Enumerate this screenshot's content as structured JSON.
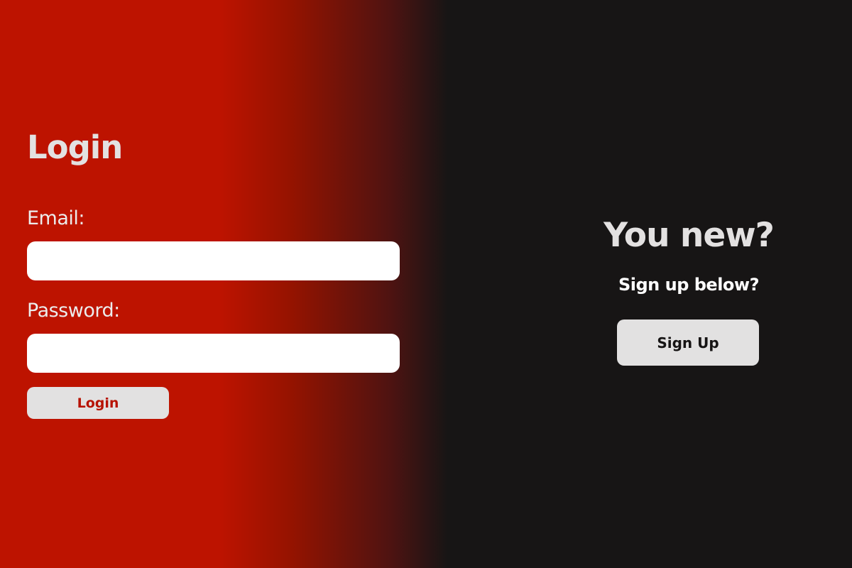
{
  "login": {
    "title": "Login",
    "email_label": "Email:",
    "email_value": "",
    "password_label": "Password:",
    "password_value": "",
    "button_label": "Login"
  },
  "signup": {
    "title": "You new?",
    "subtitle": "Sign up below?",
    "button_label": "Sign Up"
  },
  "colors": {
    "login_panel_red": "#bd1300",
    "dark_background": "#171515",
    "button_background": "#e2e1e1",
    "login_button_text": "#b71200"
  }
}
